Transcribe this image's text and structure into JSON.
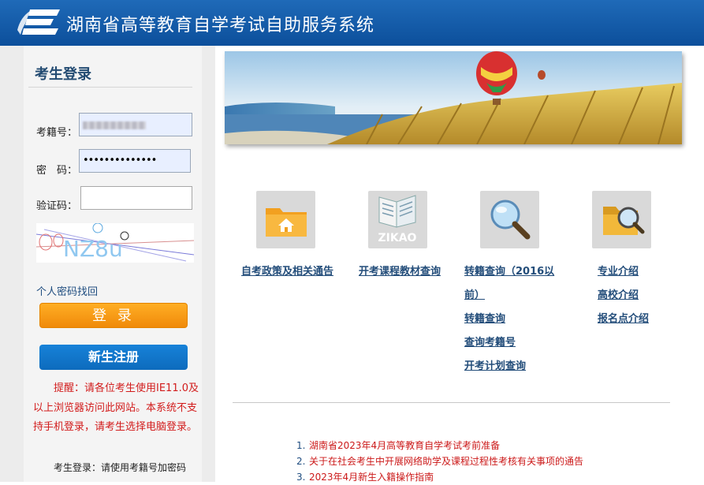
{
  "header": {
    "title": "湖南省高等教育自学考试自助服务系统",
    "brand_color": "#0c4f9b"
  },
  "login": {
    "title": "考生登录",
    "id_label": "考籍号：",
    "password_label": "密　码：",
    "password_value": "••••••••••••••",
    "captcha_label": "验证码：",
    "captcha_value": "",
    "captcha_text": "NZ8u",
    "recover_link": "个人密码找回",
    "login_button": "登 录",
    "register_button": "新生注册",
    "notice": "提醒：请各位考生使用IE11.0及以上浏览器访问此网站。本系统不支持手机登录，请考生选择电脑登录。",
    "bottom_hint": "考生登录：请使用考籍号加密码"
  },
  "tiles": [
    {
      "icon": "folder-home-icon",
      "links": [
        "自考政策及相关通告"
      ]
    },
    {
      "icon": "zikao-book-icon",
      "caption": "ZIKAO",
      "links": [
        "开考课程教材查询"
      ]
    },
    {
      "icon": "magnifier-icon",
      "links": [
        "转籍查询（2016以",
        "前）",
        "转籍查询",
        "查询考籍号",
        "开考计划查询"
      ]
    },
    {
      "icon": "folder-search-icon",
      "links": [
        "专业介绍",
        "高校介绍",
        "报名点介绍"
      ]
    }
  ],
  "news": [
    {
      "num": "1.",
      "text": "湖南省2023年4月高等教育自学考试考前准备"
    },
    {
      "num": "2.",
      "text": "关于在社会考生中开展网络助学及课程过程性考核有关事项的通告"
    },
    {
      "num": "3.",
      "text": "2023年4月新生入籍操作指南"
    }
  ],
  "colors": {
    "login_button": "#f08a0a",
    "register_button": "#0d6bbd",
    "notice": "#d21c1c",
    "link": "#234d7a"
  }
}
